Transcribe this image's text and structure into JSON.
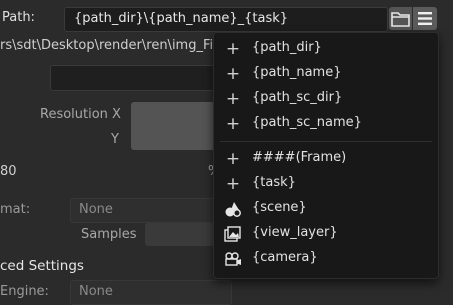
{
  "output_path": {
    "label": "Path:",
    "value": "{path_dir}\\{path_name}_{task}",
    "resolved_preview": "rs\\sdt\\Desktop\\render\\ren\\img_Fill"
  },
  "toolbar": {
    "folder_icon": "folder-icon",
    "menu_icon": "hamburger-menu-icon"
  },
  "settings": {
    "resolution_x_label": "Resolution X",
    "resolution_y_label": "Y",
    "percent_value": "80",
    "percent_sign": "%",
    "format_label": "mat:",
    "format_value": "None",
    "samples_label": "Samples",
    "advanced_header": "ced Settings",
    "engine_label": "Engine:",
    "engine_value": "None"
  },
  "menu": {
    "group1": [
      {
        "icon": "plus-icon",
        "label": "{path_dir}"
      },
      {
        "icon": "plus-icon",
        "label": "{path_name}"
      },
      {
        "icon": "plus-icon",
        "label": "{path_sc_dir}"
      },
      {
        "icon": "plus-icon",
        "label": "{path_sc_name}"
      }
    ],
    "group2": [
      {
        "icon": "plus-icon",
        "label": "####(Frame)"
      },
      {
        "icon": "plus-icon",
        "label": "{task}"
      },
      {
        "icon": "scene-icon",
        "label": "{scene}"
      },
      {
        "icon": "view-layer-icon",
        "label": "{view_layer}"
      },
      {
        "icon": "camera-icon",
        "label": "{camera}"
      }
    ]
  }
}
